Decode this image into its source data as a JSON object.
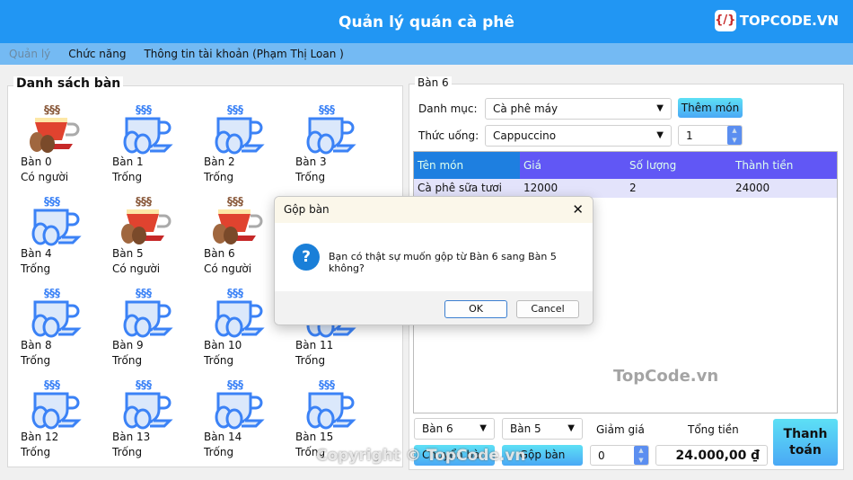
{
  "header": {
    "title": "Quản lý quán cà phê",
    "logo": "TOPCODE.VN"
  },
  "menu": [
    "Quản lý",
    "Chức năng",
    "Thông tin tài khoản (Phạm Thị Loan )"
  ],
  "tables_group": {
    "title": "Danh sách bàn",
    "tables": [
      {
        "name": "Bàn 0",
        "status": "Có người",
        "occupied": true
      },
      {
        "name": "Bàn 1",
        "status": "Trống",
        "occupied": false
      },
      {
        "name": "Bàn 2",
        "status": "Trống",
        "occupied": false
      },
      {
        "name": "Bàn 3",
        "status": "Trống",
        "occupied": false
      },
      {
        "name": "Bàn 4",
        "status": "Trống",
        "occupied": false
      },
      {
        "name": "Bàn 5",
        "status": "Có người",
        "occupied": true
      },
      {
        "name": "Bàn 6",
        "status": "Có người",
        "occupied": true
      },
      null,
      {
        "name": "Bàn 8",
        "status": "Trống",
        "occupied": false
      },
      {
        "name": "Bàn 9",
        "status": "Trống",
        "occupied": false
      },
      {
        "name": "Bàn 10",
        "status": "Trống",
        "occupied": false
      },
      {
        "name": "Bàn 11",
        "status": "Trống",
        "occupied": false
      },
      {
        "name": "Bàn 12",
        "status": "Trống",
        "occupied": false
      },
      {
        "name": "Bàn 13",
        "status": "Trống",
        "occupied": false
      },
      {
        "name": "Bàn 14",
        "status": "Trống",
        "occupied": false
      },
      {
        "name": "Bàn 15",
        "status": "Trống",
        "occupied": false
      }
    ]
  },
  "order": {
    "title": "Bàn 6",
    "category_label": "Danh mục:",
    "category_value": "Cà phê máy",
    "drink_label": "Thức uống:",
    "drink_value": "Cappuccino",
    "add_button": "Thêm món",
    "quantity": "1",
    "columns": [
      "Tên món",
      "Giá",
      "Số lượng",
      "Thành tiền"
    ],
    "rows": [
      [
        "Cà phê sữa tươi",
        "12000",
        "2",
        "24000"
      ]
    ],
    "from_table": "Bàn 6",
    "to_table": "Bàn 5",
    "switch_button": "Chuyển bàn",
    "merge_button": "Gộp bàn",
    "discount_label": "Giảm giá",
    "discount_value": "0",
    "total_label": "Tổng tiền",
    "total_value": "24.000,00 ₫",
    "pay_button": "Thanh toán"
  },
  "dialog": {
    "title": "Gộp bàn",
    "message": "Bạn có thật sự muốn gộp từ Bàn 6 sang Bàn 5 không?",
    "ok": "OK",
    "cancel": "Cancel",
    "icon": "question-icon"
  },
  "watermarks": [
    "TopCode.vn",
    "Copyright © TopCode.vn"
  ],
  "colors": {
    "header": "#2196f3",
    "menubar": "#74baf3",
    "table_header": "#6157f5",
    "accent": "#4ac8f5"
  }
}
